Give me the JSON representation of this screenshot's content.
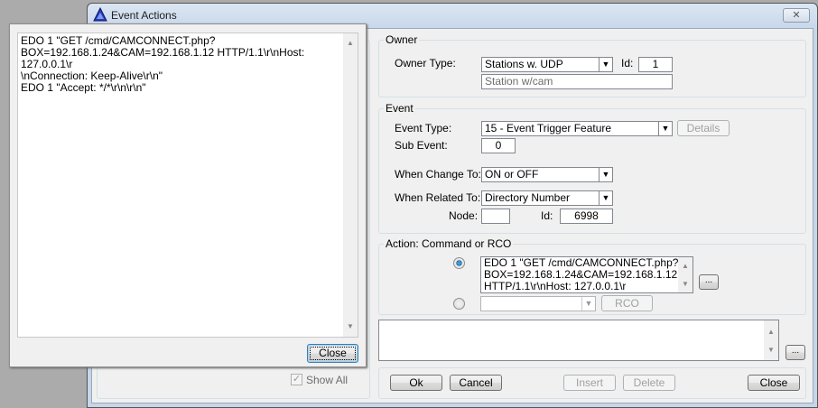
{
  "window": {
    "title": "Event Actions",
    "close_icon": "close-icon"
  },
  "owner": {
    "group_label": "Owner",
    "owner_type_label": "Owner Type:",
    "owner_type_value": "Stations w. UDP",
    "id_label": "Id:",
    "id_value": "1",
    "owner_name": "Station w/cam"
  },
  "event": {
    "group_label": "Event",
    "event_type_label": "Event Type:",
    "event_type_value": "15 - Event Trigger Feature",
    "details_label": "Details",
    "sub_event_label": "Sub Event:",
    "sub_event_value": "0",
    "when_change_label": "When Change To:",
    "when_change_value": "ON or OFF",
    "when_related_label": "When Related To:",
    "when_related_value": "Directory Number",
    "node_label": "Node:",
    "node_value": "",
    "id_label": "Id:",
    "id_value": "6998"
  },
  "action": {
    "group_label": "Action: Command or RCO",
    "command_lines": [
      "EDO 1 \"GET /cmd/CAMCONNECT.php?",
      "BOX=192.168.1.24&CAM=192.168.1.12",
      "HTTP/1.1\\r\\nHost: 127.0.0.1\\r"
    ],
    "ellipsis_label": "...",
    "rco_value": "",
    "rco_label": "RCO"
  },
  "notes": {
    "value": "",
    "ellipsis_label": "..."
  },
  "buttons": {
    "ok": "Ok",
    "cancel": "Cancel",
    "insert": "Insert",
    "delete": "Delete",
    "close": "Close"
  },
  "left": {
    "show_all_label": "Show All",
    "show_all_checked": true
  },
  "popup": {
    "lines": [
      "EDO 1 \"GET /cmd/CAMCONNECT.php?",
      "BOX=192.168.1.24&CAM=192.168.1.12 HTTP/1.1\\r\\nHost: 127.0.0.1\\r",
      "\\nConnection: Keep-Alive\\r\\n\"",
      "EDO 1 \"Accept: */*\\r\\n\\r\\n\""
    ],
    "close_label": "Close"
  }
}
